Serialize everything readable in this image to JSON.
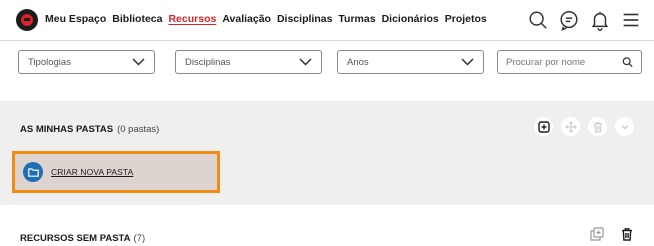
{
  "header": {
    "logo_icon": "brand-logo-icon",
    "nav": [
      {
        "label": "Meu Espaço",
        "active": false
      },
      {
        "label": "Biblioteca",
        "active": false
      },
      {
        "label": "Recursos",
        "active": true
      },
      {
        "label": "Avaliação",
        "active": false
      },
      {
        "label": "Disciplinas",
        "active": false
      },
      {
        "label": "Turmas",
        "active": false
      },
      {
        "label": "Dicionários",
        "active": false
      },
      {
        "label": "Projetos",
        "active": false
      }
    ],
    "icons": [
      "search-icon",
      "chat-icon",
      "bell-icon",
      "menu-icon"
    ]
  },
  "filters": {
    "tipologias": "Tipologias",
    "disciplinas": "Disciplinas",
    "anos": "Anos",
    "search_placeholder": "Procurar por nome"
  },
  "folders": {
    "title": "AS MINHAS PASTAS",
    "count": "(0 pastas)",
    "actions": [
      "add-icon",
      "move-icon",
      "trash-icon",
      "chevron-down-icon"
    ],
    "new_folder_label": "CRIAR NOVA PASTA"
  },
  "unfiled": {
    "title": "RECURSOS SEM PASTA",
    "count": "(7)"
  },
  "colors": {
    "brand_red": "#d8232a",
    "highlight_orange": "#f08a12",
    "folder_blue": "#1f6fb5",
    "panel_bg": "#efefef"
  }
}
